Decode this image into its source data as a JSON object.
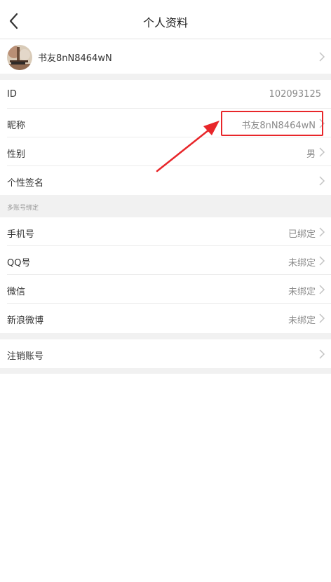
{
  "header": {
    "title": "个人资料",
    "back_icon": "chevron-left-icon"
  },
  "profile": {
    "name": "书友8nN8464wN"
  },
  "rows": {
    "id": {
      "label": "ID",
      "value": "102093125"
    },
    "nickname": {
      "label": "昵称",
      "value": "书友8nN8464wN"
    },
    "gender": {
      "label": "性别",
      "value": "男"
    },
    "signature": {
      "label": "个性签名",
      "value": ""
    }
  },
  "accounts_section": {
    "title": "多账号绑定",
    "items": [
      {
        "label": "手机号",
        "value": "已绑定"
      },
      {
        "label": "QQ号",
        "value": "未绑定"
      },
      {
        "label": "微信",
        "value": "未绑定"
      },
      {
        "label": "新浪微博",
        "value": "未绑定"
      }
    ]
  },
  "cancel_account": {
    "label": "注销账号"
  },
  "colors": {
    "annotation_red": "#e8262a",
    "gap_background": "#f1f1f1",
    "value_gray": "#8a8a8a"
  }
}
